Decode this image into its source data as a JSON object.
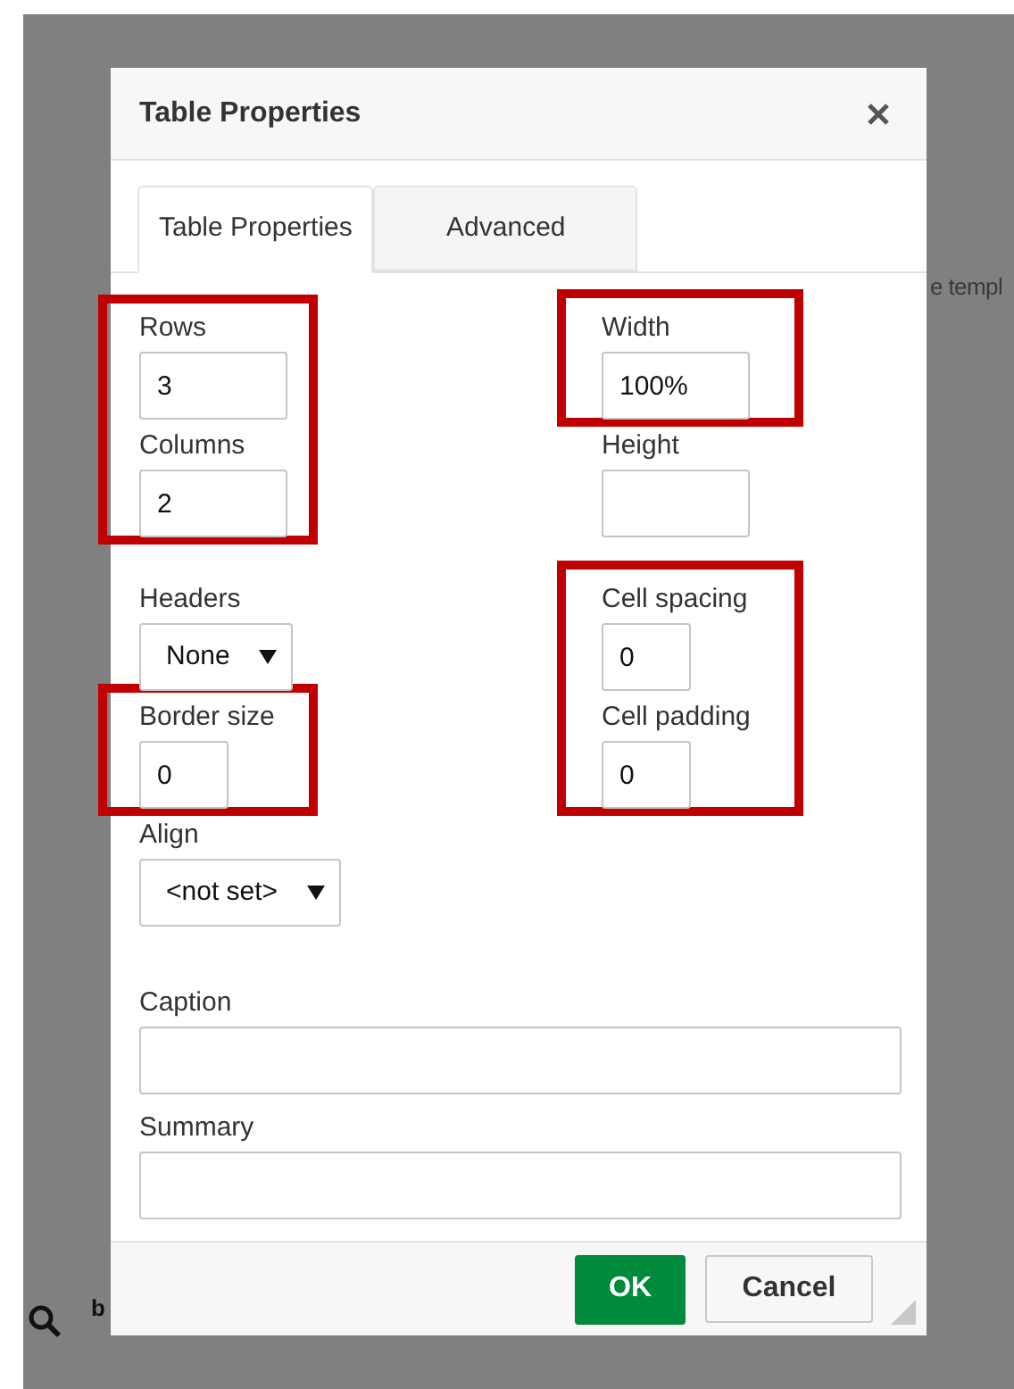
{
  "background": {
    "texts": [
      "e templ",
      "b"
    ]
  },
  "dialog": {
    "title": "Table Properties",
    "tabs": [
      {
        "label": "Table Properties",
        "selected": true
      },
      {
        "label": "Advanced",
        "selected": false
      }
    ],
    "columns": [
      {
        "groups": [
          {
            "highlighted": true,
            "fields": [
              {
                "kind": "input",
                "label": "Rows",
                "value": "3"
              },
              {
                "kind": "input",
                "label": "Columns",
                "value": "2"
              }
            ]
          },
          {
            "highlighted": false,
            "fields": [
              {
                "kind": "select",
                "label": "Headers",
                "value": "None"
              }
            ]
          },
          {
            "highlighted": true,
            "fields": [
              {
                "kind": "small",
                "label": "Border size",
                "value": "0"
              }
            ]
          },
          {
            "highlighted": false,
            "fields": [
              {
                "kind": "select",
                "label": "Align",
                "value": "<not set>"
              }
            ]
          }
        ]
      },
      {
        "groups": [
          {
            "highlighted": true,
            "fields": [
              {
                "kind": "input",
                "label": "Width",
                "value": "100%"
              }
            ]
          },
          {
            "highlighted": false,
            "fields": [
              {
                "kind": "input",
                "label": "Height"
              }
            ]
          },
          {
            "highlighted": true,
            "fields": [
              {
                "kind": "small",
                "label": "Cell spacing",
                "value": "0"
              },
              {
                "kind": "small",
                "label": "Cell padding",
                "value": "0"
              }
            ]
          }
        ]
      }
    ],
    "wide_fields": [
      {
        "label": "Caption"
      },
      {
        "label": "Summary"
      }
    ],
    "buttons": [
      {
        "label": "OK",
        "kind": "primary"
      },
      {
        "label": "Cancel",
        "kind": "secondary"
      }
    ]
  }
}
